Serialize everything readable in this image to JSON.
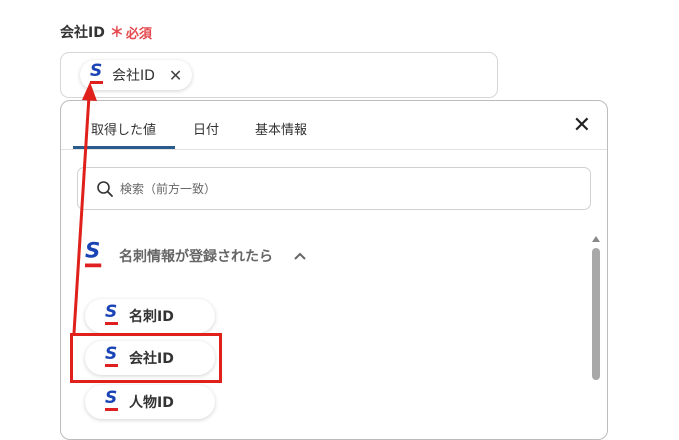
{
  "field": {
    "label": "会社ID",
    "required_mark": "＊",
    "required_text": "必須",
    "chip_label": "会社ID"
  },
  "dropdown": {
    "tabs": [
      "取得した値",
      "日付",
      "基本情報"
    ],
    "active_tab": "取得した値",
    "search_placeholder": "検索（前方一致）",
    "section_title": "名刺情報が登録されたら",
    "items": [
      {
        "label": "名刺ID"
      },
      {
        "label": "会社ID"
      },
      {
        "label": "人物ID"
      }
    ]
  },
  "colors": {
    "annotation_red": "#e0201a",
    "icon_blue": "#1a43b5",
    "icon_red": "#e02020",
    "tab_underline": "#2b5a8c",
    "required": "#e5484d"
  },
  "icons": {
    "service": "sansan-s-icon",
    "search": "search-icon",
    "close": "close-icon",
    "chevron": "chevron-up-icon"
  }
}
